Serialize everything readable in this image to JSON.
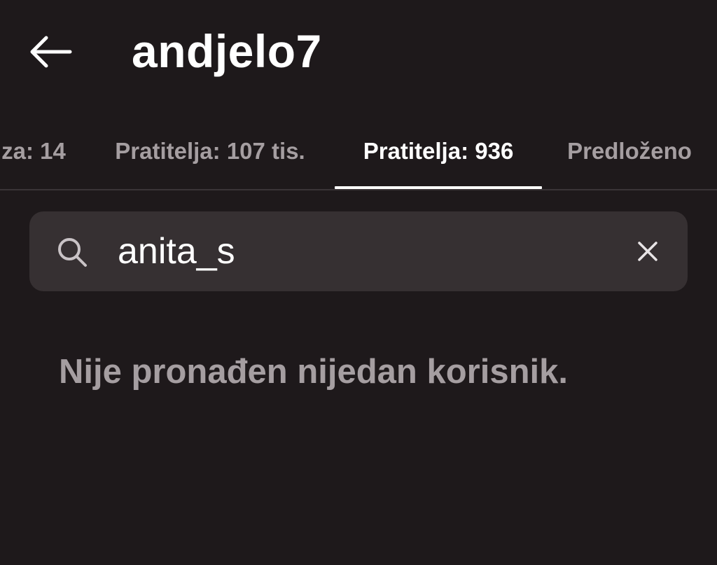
{
  "header": {
    "back_icon": "arrow-left-icon",
    "title": "andjelo7"
  },
  "tabs": [
    {
      "label": "za: 14",
      "active": false
    },
    {
      "label": "Pratitelja: 107 tis.",
      "active": false
    },
    {
      "label": "Pratitelja: 936",
      "active": true
    },
    {
      "label": "Predloženo",
      "active": false
    }
  ],
  "search": {
    "icon": "search-icon",
    "value": "anita_s",
    "clear_icon": "close-icon"
  },
  "empty_state": {
    "message": "Nije pronađen nijedan korisnik."
  },
  "colors": {
    "background": "#1e191b",
    "search_background": "#363032",
    "muted_text": "#a59ea1",
    "active_text": "#ffffff"
  }
}
